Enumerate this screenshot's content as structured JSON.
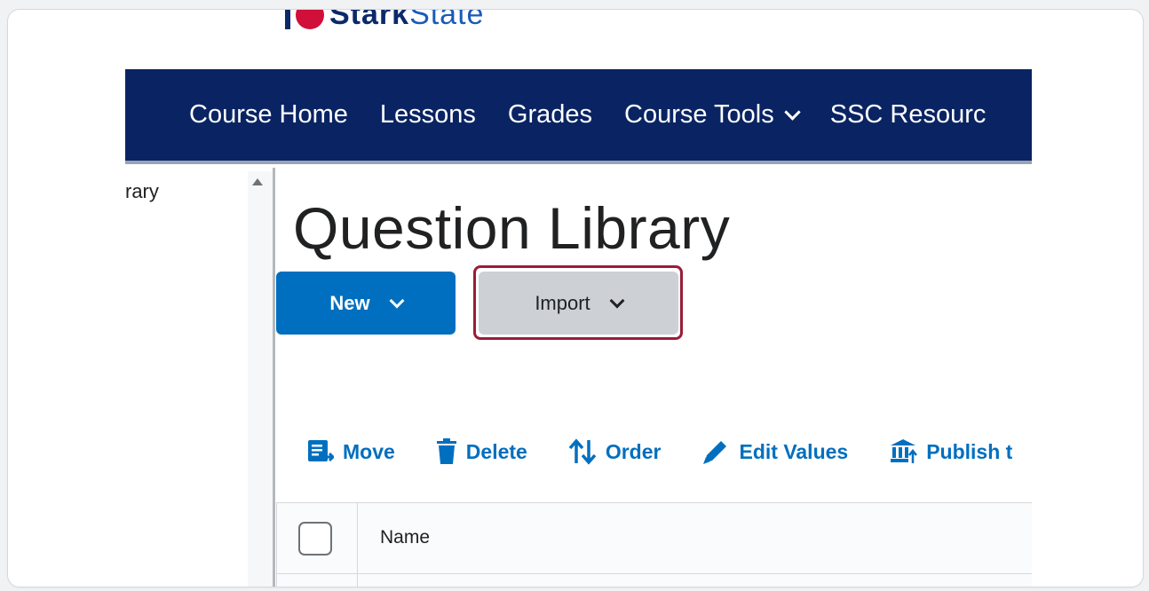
{
  "logo": {
    "text_dark": "Stark",
    "text_light": "State"
  },
  "nav": {
    "items": [
      {
        "label": "Course Home",
        "dropdown": false
      },
      {
        "label": "Lessons",
        "dropdown": false
      },
      {
        "label": "Grades",
        "dropdown": false
      },
      {
        "label": "Course Tools",
        "dropdown": true
      },
      {
        "label": "SSC Resourc",
        "dropdown": false
      }
    ]
  },
  "sidebar": {
    "partial_label": "rary"
  },
  "page": {
    "title": "Question Library"
  },
  "actions": {
    "new_label": "New",
    "import_label": "Import"
  },
  "toolbar": {
    "items": [
      {
        "label": "Move",
        "icon": "move-icon"
      },
      {
        "label": "Delete",
        "icon": "trash-icon"
      },
      {
        "label": "Order",
        "icon": "order-icon"
      },
      {
        "label": "Edit Values",
        "icon": "pencil-icon"
      },
      {
        "label": "Publish t",
        "icon": "publish-icon"
      }
    ]
  },
  "table": {
    "headers": [
      "Name"
    ]
  },
  "colors": {
    "nav_bg": "#0a2463",
    "primary": "#006fbf",
    "highlight": "#9b1c3a"
  }
}
